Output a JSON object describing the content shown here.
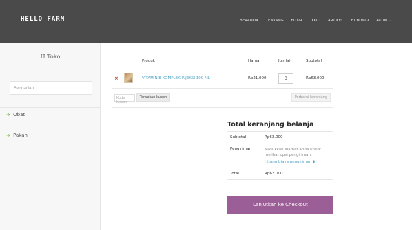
{
  "header": {
    "brand": "HELLO FARM",
    "nav": [
      {
        "label": "BERANDA"
      },
      {
        "label": "TENTANG"
      },
      {
        "label": "FITUR"
      },
      {
        "label": "TOKO"
      },
      {
        "label": "ARTIKEL"
      },
      {
        "label": "HUBUNGI"
      },
      {
        "label": "AKUN ⌄"
      }
    ],
    "active_nav": "TOKO",
    "accent": "#8fd14f"
  },
  "sidebar": {
    "title": "H Toko",
    "search_placeholder": "Pencarian...",
    "items": [
      {
        "label": "Obat"
      },
      {
        "label": "Pakan"
      }
    ]
  },
  "cart": {
    "headers": {
      "product": "Produk",
      "price": "Harga",
      "quantity": "Jumlah",
      "subtotal": "Subtotal"
    },
    "items": [
      {
        "remove_icon": "×",
        "image_icon": "product-thumbnail",
        "name": "VITAMIN B KOMPLEK INJEKSI 100 ML",
        "price": "Rp21.000",
        "quantity": "3",
        "subtotal": "Rp63.000"
      }
    ],
    "coupon_placeholder": "Kode kupon",
    "apply_coupon_label": "Terapkan kupon",
    "update_cart_label": "Perbarui keranjang"
  },
  "totals": {
    "title": "Total keranjang belanja",
    "subtotal_label": "Subtotal",
    "subtotal_value": "Rp63.000",
    "shipping_label": "Pengiriman",
    "shipping_text": "Masukkan alamat Anda untuk melihat opsi pengiriman.",
    "shipping_link": "Hitung biaya pengiriman",
    "total_label": "Total",
    "total_value": "Rp63.000",
    "checkout_label": "Lanjutkan ke Checkout",
    "checkout_color": "#9c5e96"
  }
}
